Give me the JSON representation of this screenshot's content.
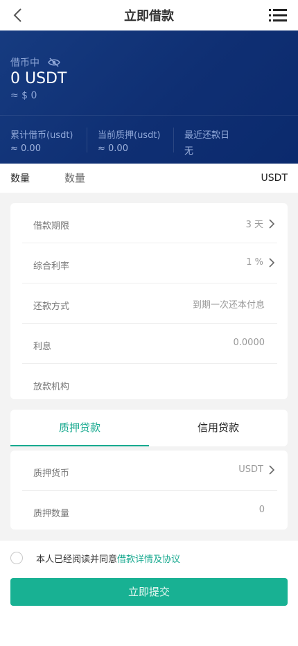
{
  "header": {
    "title": "立即借款",
    "back_icon": "chevron-left-icon",
    "menu_icon": "list-menu-icon"
  },
  "hero": {
    "status_label": "借币中",
    "amount": "0 USDT",
    "approx": "≈ $ 0",
    "stats": [
      {
        "label": "累计借币(usdt)",
        "value": "≈ 0.00"
      },
      {
        "label": "当前质押(usdt)",
        "value": "≈ 0.00"
      },
      {
        "label": "最近还款日",
        "value": "无"
      }
    ]
  },
  "quantity": {
    "label": "数量",
    "placeholder": "数量",
    "unit": "USDT"
  },
  "details": [
    {
      "label": "借款期限",
      "value": "3 天"
    },
    {
      "label": "综合利率",
      "value": "1 %"
    },
    {
      "label": "还款方式",
      "value": "到期一次还本付息"
    },
    {
      "label": "利息",
      "value": "0.0000"
    },
    {
      "label": "放款机构",
      "value": ""
    }
  ],
  "tabs": [
    {
      "label": "质押贷款",
      "active": true
    },
    {
      "label": "信用贷款",
      "active": false
    }
  ],
  "collateral": [
    {
      "label": "质押货币",
      "value": "USDT"
    },
    {
      "label": "质押数量",
      "value": "0"
    }
  ],
  "agreement": {
    "text": "本人已经阅读并同意",
    "link": "借款详情及协议"
  },
  "submit_label": "立即提交",
  "colors": {
    "accent": "#17a98f",
    "hero_bg": "#133780",
    "submit_bg": "#18b193"
  }
}
